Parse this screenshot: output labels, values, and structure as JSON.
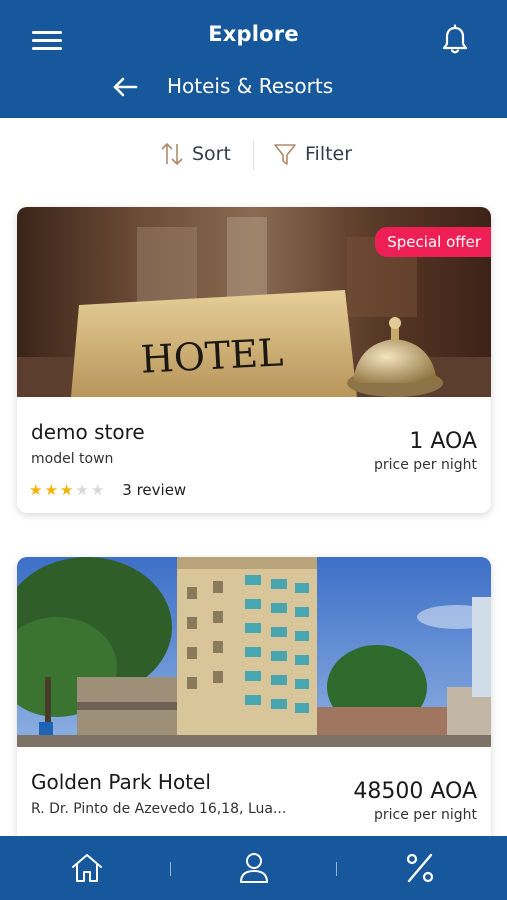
{
  "header": {
    "app_title": "Explore",
    "page_title": "Hoteis & Resorts",
    "menu_icon": "hamburger-menu-icon",
    "bell_icon": "bell-icon",
    "back_icon": "arrow-left-icon"
  },
  "toolbar": {
    "sort_label": "Sort",
    "filter_label": "Filter",
    "sort_icon": "sort-arrows-icon",
    "filter_icon": "funnel-icon"
  },
  "hotels": [
    {
      "name": "demo store",
      "address": "model town",
      "price": "1 AOA",
      "price_label": "price per night",
      "badge": "Special offer",
      "rating": 3,
      "rating_max": 5,
      "review_text": "3 review",
      "image_sign_text": "HOTEL"
    },
    {
      "name": "Golden Park Hotel",
      "address": "R. Dr. Pinto de Azevedo 16,18, Lua...",
      "price": "48500 AOA",
      "price_label": "price per night"
    }
  ],
  "bottom_nav": {
    "items": [
      {
        "icon": "home-icon"
      },
      {
        "icon": "user-icon"
      },
      {
        "icon": "percent-icon"
      }
    ]
  },
  "colors": {
    "primary": "#17579b",
    "badge": "#ed1f55",
    "star_on": "#f5b301",
    "star_off": "#d9d9d9"
  }
}
